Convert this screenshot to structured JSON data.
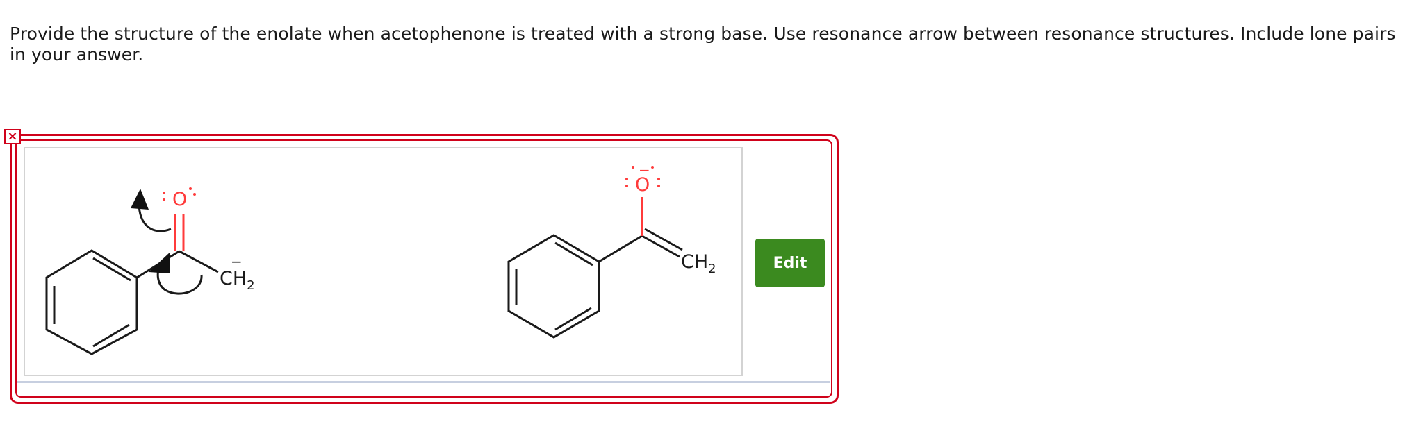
{
  "question": {
    "text": "Provide the structure of the enolate when acetophenone is treated with a strong base. Use resonance arrow between resonance structures. Include lone pairs in your answer."
  },
  "answer_box": {
    "close_symbol": "×",
    "edit_label": "Edit"
  },
  "structures": {
    "left": {
      "oxygen": "O",
      "carbon_label": "CH",
      "carbon_subscript": "2",
      "carbon_charge": "−"
    },
    "right": {
      "oxygen": "O",
      "oxygen_charge": "−",
      "carbon_label": "CH",
      "carbon_subscript": "2"
    }
  },
  "colors": {
    "error_border": "#d0021b",
    "edit_button": "#3b8a1f",
    "oxygen": "#ff3b3b"
  }
}
